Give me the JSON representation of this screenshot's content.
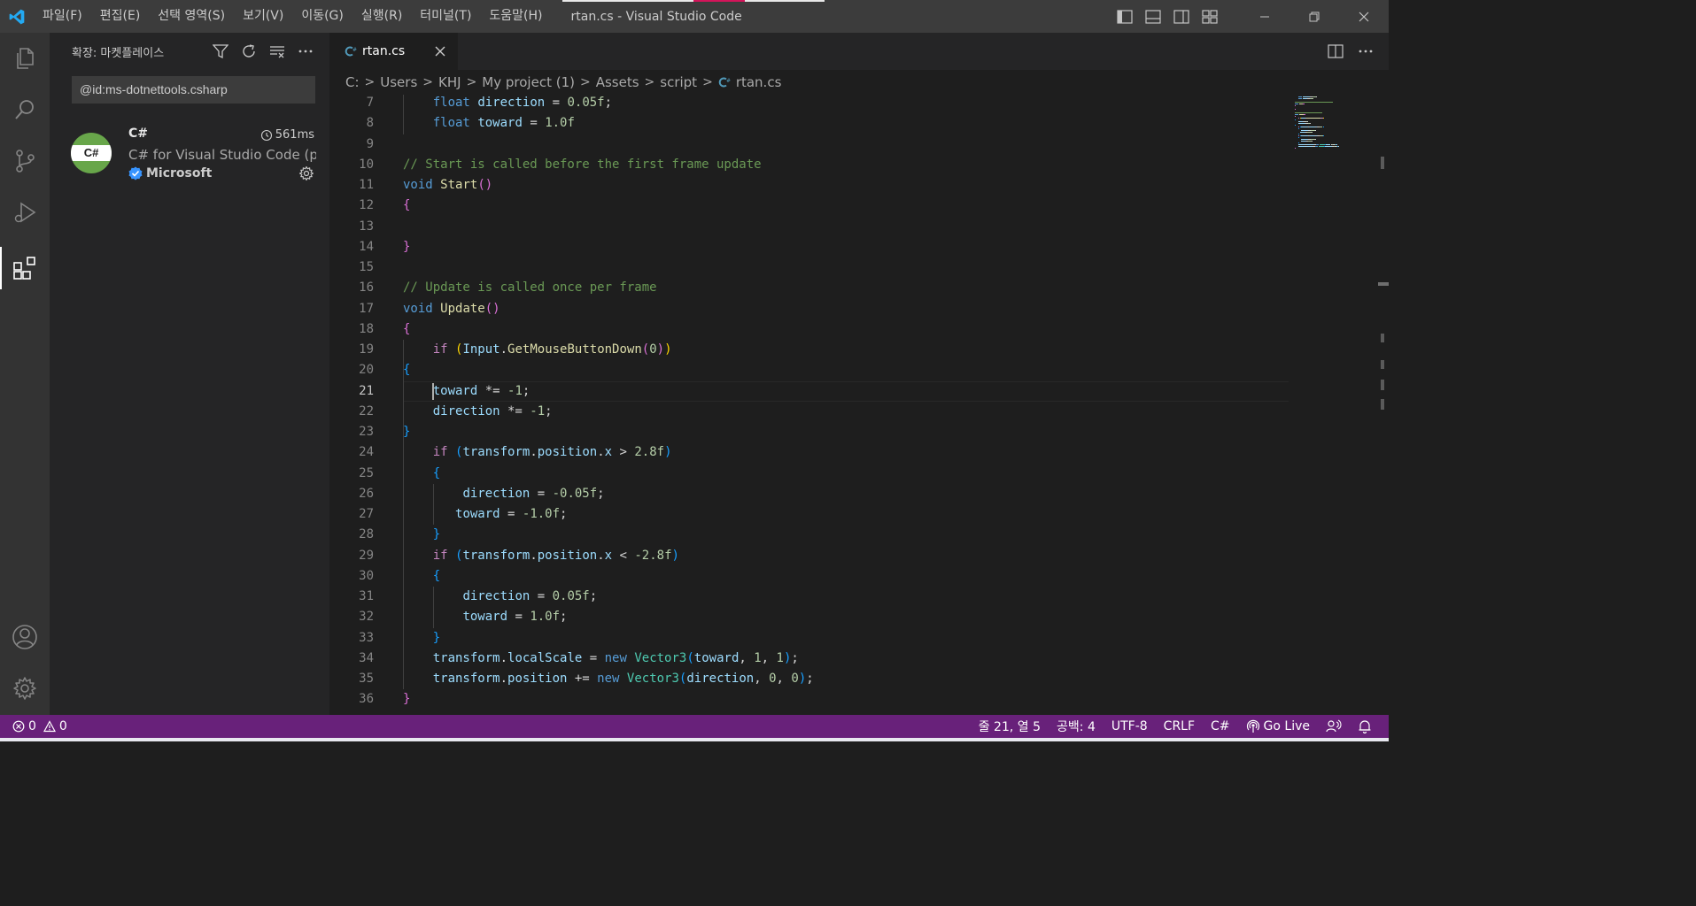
{
  "window": {
    "title": "rtan.cs - Visual Studio Code"
  },
  "menu": [
    {
      "label": "파일(F)"
    },
    {
      "label": "편집(E)"
    },
    {
      "label": "선택 영역(S)"
    },
    {
      "label": "보기(V)"
    },
    {
      "label": "이동(G)"
    },
    {
      "label": "실행(R)"
    },
    {
      "label": "터미널(T)"
    },
    {
      "label": "도움말(H)"
    }
  ],
  "activity_bar": [
    "files-icon",
    "search-icon",
    "source-control-icon",
    "run-debug-icon",
    "extensions-icon",
    "account-icon",
    "settings-gear-icon"
  ],
  "sidebar": {
    "title": "확장: 마켓플레이스",
    "search_value": "@id:ms-dotnettools.csharp",
    "extension": {
      "icon_label": "C#",
      "name": "C#",
      "time": "561ms",
      "description": "C# for Visual Studio Code (p...",
      "publisher": "Microsoft"
    }
  },
  "tab": {
    "label": "rtan.cs"
  },
  "breadcrumbs": [
    "C:",
    "Users",
    "KHJ",
    "My project (1)",
    "Assets",
    "script"
  ],
  "breadcrumb_file": "rtan.cs",
  "editor": {
    "line_numbers": [
      "7",
      "8",
      "9",
      "10",
      "11",
      "12",
      "13",
      "14",
      "15",
      "16",
      "17",
      "18",
      "19",
      "20",
      "21",
      "22",
      "23",
      "24",
      "25",
      "26",
      "27",
      "28",
      "29",
      "30",
      "31",
      "32",
      "33",
      "34",
      "35",
      "36"
    ],
    "current_line": "21",
    "lines": [
      [
        [
          "    ",
          "op"
        ],
        [
          "float",
          "kw"
        ],
        [
          " ",
          "op"
        ],
        [
          "direction",
          "var"
        ],
        [
          " = ",
          "op"
        ],
        [
          "0.05f",
          "num"
        ],
        [
          ";",
          "op"
        ]
      ],
      [
        [
          "    ",
          "op"
        ],
        [
          "float",
          "kw"
        ],
        [
          " ",
          "op"
        ],
        [
          "toward",
          "var"
        ],
        [
          " = ",
          "op"
        ],
        [
          "1.0f",
          "num"
        ]
      ],
      [],
      [
        [
          "// Start is called before the first frame update",
          "cmt"
        ]
      ],
      [
        [
          "void",
          "kw"
        ],
        [
          " ",
          "op"
        ],
        [
          "Start",
          "fn"
        ],
        [
          "()",
          "b1"
        ]
      ],
      [
        [
          "{",
          "b1"
        ]
      ],
      [],
      [
        [
          "}",
          "b1"
        ]
      ],
      [],
      [
        [
          "// Update is called once per frame",
          "cmt"
        ]
      ],
      [
        [
          "void",
          "kw"
        ],
        [
          " ",
          "op"
        ],
        [
          "Update",
          "fn"
        ],
        [
          "()",
          "b1"
        ]
      ],
      [
        [
          "{",
          "b1"
        ]
      ],
      [
        [
          "    ",
          "op"
        ],
        [
          "if",
          "ctl"
        ],
        [
          " ",
          "op"
        ],
        [
          "(",
          "b2"
        ],
        [
          "Input",
          "var"
        ],
        [
          ".",
          "op"
        ],
        [
          "GetMouseButtonDown",
          "fn"
        ],
        [
          "(",
          "b1"
        ],
        [
          "0",
          "num"
        ],
        [
          ")",
          "b1"
        ],
        [
          ")",
          "b2"
        ]
      ],
      [
        [
          "{",
          "b3"
        ]
      ],
      [
        [
          "    ",
          "op"
        ],
        [
          "toward",
          "var"
        ],
        [
          " *= ",
          "op"
        ],
        [
          "-1",
          "num"
        ],
        [
          ";",
          "op"
        ]
      ],
      [
        [
          "    ",
          "op"
        ],
        [
          "direction",
          "var"
        ],
        [
          " *= ",
          "op"
        ],
        [
          "-1",
          "num"
        ],
        [
          ";",
          "op"
        ]
      ],
      [
        [
          "}",
          "b3"
        ]
      ],
      [
        [
          "    ",
          "op"
        ],
        [
          "if",
          "ctl"
        ],
        [
          " ",
          "op"
        ],
        [
          "(",
          "b3"
        ],
        [
          "transform",
          "var"
        ],
        [
          ".",
          "op"
        ],
        [
          "position",
          "var"
        ],
        [
          ".",
          "op"
        ],
        [
          "x",
          "var"
        ],
        [
          " > ",
          "op"
        ],
        [
          "2.8f",
          "num"
        ],
        [
          ")",
          "b3"
        ]
      ],
      [
        [
          "    ",
          "op"
        ],
        [
          "{",
          "b3"
        ]
      ],
      [
        [
          "        ",
          "op"
        ],
        [
          "direction",
          "var"
        ],
        [
          " = ",
          "op"
        ],
        [
          "-0.05f",
          "num"
        ],
        [
          ";",
          "op"
        ]
      ],
      [
        [
          "       ",
          "op"
        ],
        [
          "toward",
          "var"
        ],
        [
          " = ",
          "op"
        ],
        [
          "-1.0f",
          "num"
        ],
        [
          ";",
          "op"
        ]
      ],
      [
        [
          "    ",
          "op"
        ],
        [
          "}",
          "b3"
        ]
      ],
      [
        [
          "    ",
          "op"
        ],
        [
          "if",
          "ctl"
        ],
        [
          " ",
          "op"
        ],
        [
          "(",
          "b3"
        ],
        [
          "transform",
          "var"
        ],
        [
          ".",
          "op"
        ],
        [
          "position",
          "var"
        ],
        [
          ".",
          "op"
        ],
        [
          "x",
          "var"
        ],
        [
          " < ",
          "op"
        ],
        [
          "-2.8f",
          "num"
        ],
        [
          ")",
          "b3"
        ]
      ],
      [
        [
          "    ",
          "op"
        ],
        [
          "{",
          "b3"
        ]
      ],
      [
        [
          "        ",
          "op"
        ],
        [
          "direction",
          "var"
        ],
        [
          " = ",
          "op"
        ],
        [
          "0.05f",
          "num"
        ],
        [
          ";",
          "op"
        ]
      ],
      [
        [
          "        ",
          "op"
        ],
        [
          "toward",
          "var"
        ],
        [
          " = ",
          "op"
        ],
        [
          "1.0f",
          "num"
        ],
        [
          ";",
          "op"
        ]
      ],
      [
        [
          "    ",
          "op"
        ],
        [
          "}",
          "b3"
        ]
      ],
      [
        [
          "    ",
          "op"
        ],
        [
          "transform",
          "var"
        ],
        [
          ".",
          "op"
        ],
        [
          "localScale",
          "var"
        ],
        [
          " = ",
          "op"
        ],
        [
          "new",
          "kw"
        ],
        [
          " ",
          "op"
        ],
        [
          "Vector3",
          "type"
        ],
        [
          "(",
          "b3"
        ],
        [
          "toward",
          "var"
        ],
        [
          ", ",
          "op"
        ],
        [
          "1",
          "num"
        ],
        [
          ", ",
          "op"
        ],
        [
          "1",
          "num"
        ],
        [
          ")",
          "b3"
        ],
        [
          ";",
          "op"
        ]
      ],
      [
        [
          "    ",
          "op"
        ],
        [
          "transform",
          "var"
        ],
        [
          ".",
          "op"
        ],
        [
          "position",
          "var"
        ],
        [
          " += ",
          "op"
        ],
        [
          "new",
          "kw"
        ],
        [
          " ",
          "op"
        ],
        [
          "Vector3",
          "type"
        ],
        [
          "(",
          "b3"
        ],
        [
          "direction",
          "var"
        ],
        [
          ", ",
          "op"
        ],
        [
          "0",
          "num"
        ],
        [
          ", ",
          "op"
        ],
        [
          "0",
          "num"
        ],
        [
          ")",
          "b3"
        ],
        [
          ";",
          "op"
        ]
      ],
      [
        [
          "}",
          "b1"
        ]
      ]
    ]
  },
  "status": {
    "errors": "0",
    "warnings": "0",
    "position": "줄 21, 열 5",
    "spaces": "공백: 4",
    "encoding": "UTF-8",
    "eol": "CRLF",
    "language": "C#",
    "go_live": "Go Live"
  },
  "colors": {
    "statusbar": "#68217a",
    "titlebar": "#3c3c3c",
    "activitybar": "#333333",
    "sidebar": "#252526",
    "editor": "#1e1e1e",
    "vscode_blue": "#23a9f2",
    "csharp_green": "#68a64a"
  }
}
